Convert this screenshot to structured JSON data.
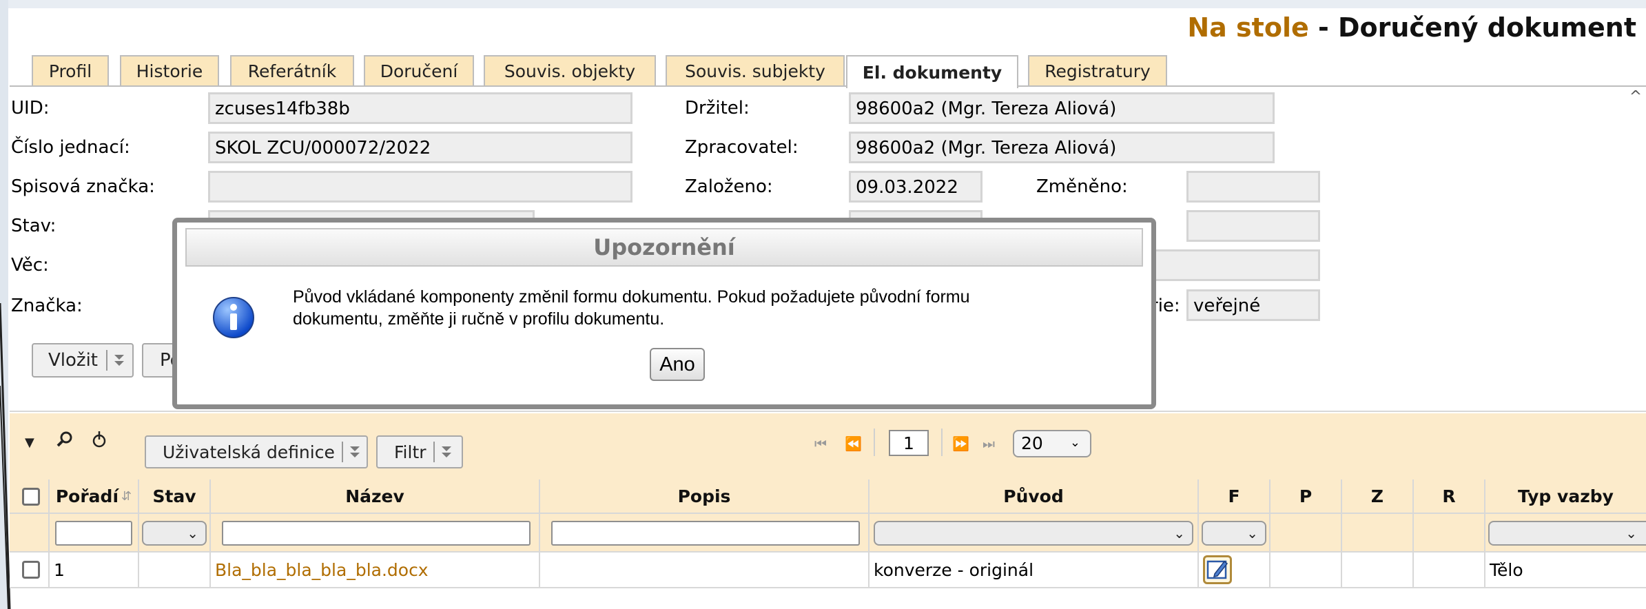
{
  "header": {
    "title_part1": "Na stole",
    "title_part2": " - Doručený dokument"
  },
  "tabs": [
    {
      "label": "Profil"
    },
    {
      "label": "Historie"
    },
    {
      "label": "Referátník"
    },
    {
      "label": "Doručení"
    },
    {
      "label": "Souvis. objekty"
    },
    {
      "label": "Souvis. subjekty"
    },
    {
      "label": "El. dokumenty",
      "active": true
    },
    {
      "label": "Registratury"
    }
  ],
  "form": {
    "uid_label": "UID:",
    "uid_value": "zcuses14fb38b",
    "cj_label": "Číslo jednací:",
    "cj_value": "SKOL ZCU/000072/2022",
    "spis_label": "Spisová značka:",
    "spis_value": "",
    "stav_label": "Stav:",
    "vec_label": "Věc:",
    "znacka_label": "Značka:",
    "drzitel_label": "Držitel:",
    "drzitel_value": "98600a2 (Mgr. Tereza Aliová)",
    "zprac_label": "Zpracovatel:",
    "zprac_value": "98600a2 (Mgr. Tereza Aliová)",
    "zalozeno_label": "Založeno:",
    "zalozeno_value": "09.03.2022",
    "zmeneno_label": "Změněno:",
    "zmeneno_value": "",
    "kategorie_label_partial": "rie:",
    "kategorie_value": "veřejné"
  },
  "actions": {
    "vlozit_label": "Vložit",
    "second_partial": "Po"
  },
  "grid": {
    "toolbar": {
      "user_def_label": "Uživatelská definice",
      "filter_label": "Filtr"
    },
    "pager": {
      "page": "1",
      "page_size": "20"
    },
    "columns": [
      "Pořadí",
      "Stav",
      "Název",
      "Popis",
      "Původ",
      "F",
      "P",
      "Z",
      "R",
      "Typ vazby"
    ],
    "rows": [
      {
        "poradi": "1",
        "stav": "",
        "nazev": "Bla_bla_bla_bla_bla.docx",
        "popis": "",
        "puvod": "konverze - originál",
        "typ_vazby": "Tělo"
      }
    ]
  },
  "modal": {
    "title": "Upozornění",
    "message_line1": "Původ vkládané komponenty změnil formu dokumentu. Pokud požadujete původní formu",
    "message_line2": "dokumentu, změňte ji ručně v profilu dokumentu.",
    "ok_label": "Ano"
  },
  "colors": {
    "accent": "#b06d00",
    "tab_bg": "#fbe7bd",
    "grid_bg": "#fcebcb",
    "link": "#b06d00"
  }
}
